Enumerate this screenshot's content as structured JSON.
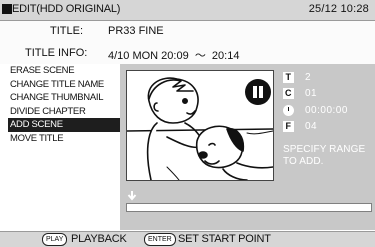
{
  "header": {
    "mode": "EDIT(HDD ORIGINAL)",
    "datetime": "25/12 10:28"
  },
  "info": {
    "title_label": "TITLE:",
    "title_value": "PR33 FINE",
    "title_info_label": "TITLE INFO:",
    "title_info_value": "4/10 MON 20:09  ～  20:14"
  },
  "menu": {
    "items": [
      {
        "label": "ERASE SCENE"
      },
      {
        "label": "CHANGE TITLE NAME"
      },
      {
        "label": "CHANGE THUMBNAIL"
      },
      {
        "label": "DIVIDE CHAPTER"
      },
      {
        "label": "ADD SCENE",
        "selected": true
      },
      {
        "label": "MOVE TITLE"
      }
    ]
  },
  "status": {
    "title_icon": "T",
    "title_number": "2",
    "chapter_icon": "C",
    "chapter_number": "01",
    "time_icon": "clock-icon",
    "time": "00:00:00",
    "frame_icon": "F",
    "frame_number": "04",
    "message": "SPECIFY RANGE TO ADD."
  },
  "footer": {
    "play_key": "PLAY",
    "play_label": "PLAYBACK",
    "enter_key": "ENTER",
    "enter_label": "SET START POINT"
  },
  "colors": {
    "header_bg": "#d6d6d6",
    "panel_bg": "#c8c8c8",
    "selected_bg": "#1e1e1e"
  }
}
